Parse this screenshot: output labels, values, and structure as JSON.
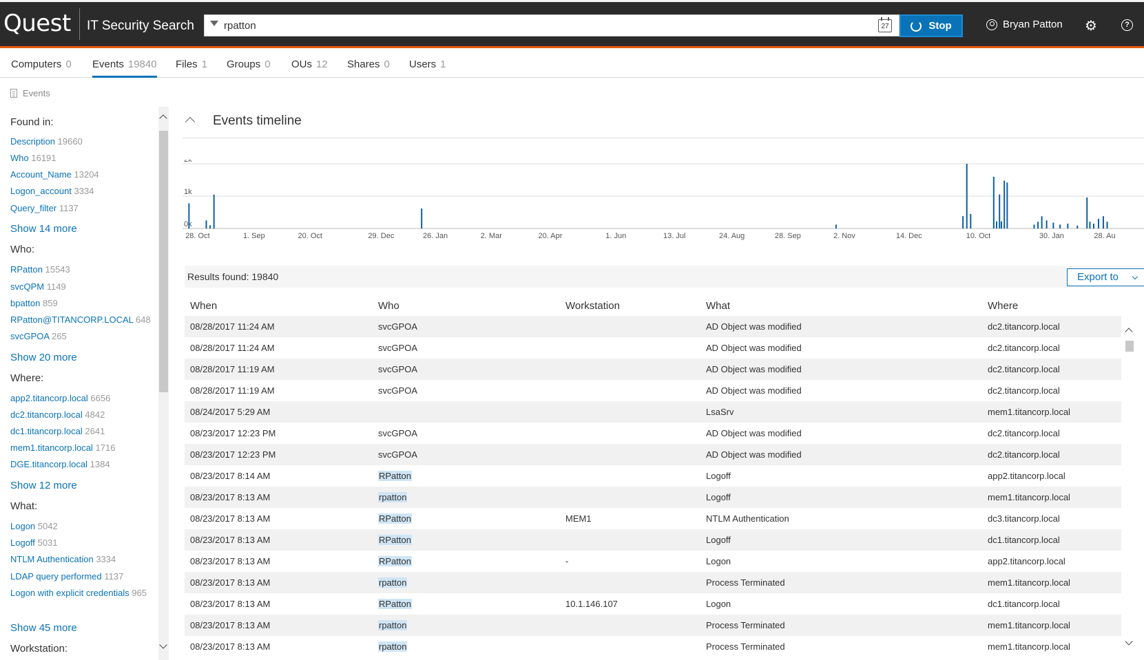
{
  "header": {
    "logo": "Quest",
    "app_title": "IT Security Search",
    "search_value": "rpatton",
    "calendar_day": "27",
    "stop_label": "Stop",
    "user_name": "Bryan Patton",
    "help_glyph": "?"
  },
  "tabs": [
    {
      "label": "Computers",
      "count": "0"
    },
    {
      "label": "Events",
      "count": "19840",
      "active": true
    },
    {
      "label": "Files",
      "count": "1"
    },
    {
      "label": "Groups",
      "count": "0"
    },
    {
      "label": "OUs",
      "count": "12"
    },
    {
      "label": "Shares",
      "count": "0"
    },
    {
      "label": "Users",
      "count": "1"
    }
  ],
  "breadcrumb": "Events",
  "facets": {
    "found_in": {
      "title": "Found in:",
      "items": [
        {
          "label": "Description",
          "count": "19660"
        },
        {
          "label": "Who",
          "count": "16191"
        },
        {
          "label": "Account_Name",
          "count": "13204"
        },
        {
          "label": "Logon_account",
          "count": "3334"
        },
        {
          "label": "Query_filter",
          "count": "1137"
        }
      ],
      "more": "Show 14 more"
    },
    "who": {
      "title": "Who:",
      "items": [
        {
          "label": "RPatton",
          "count": "15543"
        },
        {
          "label": "svcQPM",
          "count": "1149"
        },
        {
          "label": "bpatton",
          "count": "859"
        },
        {
          "label": "RPatton@TITANCORP.LOCAL",
          "count": "648"
        },
        {
          "label": "svcGPOA",
          "count": "265"
        }
      ],
      "more": "Show 20 more"
    },
    "where": {
      "title": "Where:",
      "items": [
        {
          "label": "app2.titancorp.local",
          "count": "6656"
        },
        {
          "label": "dc2.titancorp.local",
          "count": "4842"
        },
        {
          "label": "dc1.titancorp.local",
          "count": "2641"
        },
        {
          "label": "mem1.titancorp.local",
          "count": "1716"
        },
        {
          "label": "DGE.titancorp.local",
          "count": "1384"
        }
      ],
      "more": "Show 12 more"
    },
    "what": {
      "title": "What:",
      "items": [
        {
          "label": "Logon",
          "count": "5042"
        },
        {
          "label": "Logoff",
          "count": "5031"
        },
        {
          "label": "NTLM Authentication",
          "count": "3334"
        },
        {
          "label": "LDAP query performed",
          "count": "1137"
        },
        {
          "label": "Logon with explicit credentials",
          "count": "965"
        }
      ],
      "more": "Show 45 more"
    },
    "workstation_title": "Workstation:"
  },
  "timeline": {
    "title": "Events timeline",
    "accent_color": "#0a5fa3"
  },
  "chart_data": {
    "type": "bar",
    "y_ticks": [
      "0k",
      "1k",
      "2k"
    ],
    "ylim": [
      0,
      2000
    ],
    "x_ticks": [
      "28. Oct",
      "1. Sep",
      "20. Oct",
      "29. Dec",
      "26. Jan",
      "2. Mar",
      "20. Apr",
      "1. Jun",
      "13. Jul",
      "24. Aug",
      "28. Sep",
      "2. Nov",
      "14. Dec",
      "10. Oct",
      "30. Jan",
      "28. Au"
    ],
    "x_tick_fraction": [
      0.003,
      0.063,
      0.12,
      0.193,
      0.25,
      0.31,
      0.37,
      0.44,
      0.5,
      0.558,
      0.616,
      0.677,
      0.742,
      0.815,
      0.891,
      0.948
    ],
    "bars": [
      {
        "x": 0.006,
        "v": 780
      },
      {
        "x": 0.024,
        "v": 250
      },
      {
        "x": 0.028,
        "v": 100
      },
      {
        "x": 0.032,
        "v": 1050
      },
      {
        "x": 0.248,
        "v": 620
      },
      {
        "x": 0.679,
        "v": 120
      },
      {
        "x": 0.811,
        "v": 380
      },
      {
        "x": 0.815,
        "v": 2000
      },
      {
        "x": 0.819,
        "v": 450
      },
      {
        "x": 0.843,
        "v": 1600
      },
      {
        "x": 0.846,
        "v": 220
      },
      {
        "x": 0.849,
        "v": 1050
      },
      {
        "x": 0.851,
        "v": 220
      },
      {
        "x": 0.854,
        "v": 1480
      },
      {
        "x": 0.857,
        "v": 1420
      },
      {
        "x": 0.885,
        "v": 120
      },
      {
        "x": 0.889,
        "v": 210
      },
      {
        "x": 0.893,
        "v": 380
      },
      {
        "x": 0.898,
        "v": 250
      },
      {
        "x": 0.905,
        "v": 180
      },
      {
        "x": 0.912,
        "v": 120
      },
      {
        "x": 0.92,
        "v": 150
      },
      {
        "x": 0.93,
        "v": 90
      },
      {
        "x": 0.94,
        "v": 960
      },
      {
        "x": 0.943,
        "v": 210
      },
      {
        "x": 0.947,
        "v": 150
      },
      {
        "x": 0.952,
        "v": 300
      },
      {
        "x": 0.957,
        "v": 380
      },
      {
        "x": 0.961,
        "v": 210
      }
    ]
  },
  "results": {
    "found_text": "Results found: 19840",
    "export_label": "Export to"
  },
  "table": {
    "columns": [
      "When",
      "Who",
      "Workstation",
      "What",
      "Where"
    ],
    "rows": [
      {
        "when": "08/28/2017 11:24 AM",
        "who": "svcGPOA",
        "hl": false,
        "ws": "",
        "what": "AD Object was modified",
        "where": "dc2.titancorp.local"
      },
      {
        "when": "08/28/2017 11:24 AM",
        "who": "svcGPOA",
        "hl": false,
        "ws": "",
        "what": "AD Object was modified",
        "where": "dc2.titancorp.local"
      },
      {
        "when": "08/28/2017 11:19 AM",
        "who": "svcGPOA",
        "hl": false,
        "ws": "",
        "what": "AD Object was modified",
        "where": "dc2.titancorp.local"
      },
      {
        "when": "08/28/2017 11:19 AM",
        "who": "svcGPOA",
        "hl": false,
        "ws": "",
        "what": "AD Object was modified",
        "where": "dc2.titancorp.local"
      },
      {
        "when": "08/24/2017 5:29 AM",
        "who": "",
        "hl": false,
        "ws": "",
        "what": "LsaSrv",
        "where": "mem1.titancorp.local"
      },
      {
        "when": "08/23/2017 12:23 PM",
        "who": "svcGPOA",
        "hl": false,
        "ws": "",
        "what": "AD Object was modified",
        "where": "dc2.titancorp.local"
      },
      {
        "when": "08/23/2017 12:23 PM",
        "who": "svcGPOA",
        "hl": false,
        "ws": "",
        "what": "AD Object was modified",
        "where": "dc2.titancorp.local"
      },
      {
        "when": "08/23/2017 8:14 AM",
        "who": "RPatton",
        "hl": true,
        "ws": "",
        "what": "Logoff",
        "where": "app2.titancorp.local"
      },
      {
        "when": "08/23/2017 8:13 AM",
        "who": "rpatton",
        "hl": true,
        "ws": "",
        "what": "Logoff",
        "where": "mem1.titancorp.local"
      },
      {
        "when": "08/23/2017 8:13 AM",
        "who": "RPatton",
        "hl": true,
        "ws": "MEM1",
        "what": "NTLM Authentication",
        "where": "dc3.titancorp.local"
      },
      {
        "when": "08/23/2017 8:13 AM",
        "who": "RPatton",
        "hl": true,
        "ws": "",
        "what": "Logoff",
        "where": "dc1.titancorp.local"
      },
      {
        "when": "08/23/2017 8:13 AM",
        "who": "RPatton",
        "hl": true,
        "ws": "-",
        "what": "Logon",
        "where": "app2.titancorp.local"
      },
      {
        "when": "08/23/2017 8:13 AM",
        "who": "rpatton",
        "hl": true,
        "ws": "",
        "what": "Process Terminated",
        "where": "mem1.titancorp.local"
      },
      {
        "when": "08/23/2017 8:13 AM",
        "who": "RPatton",
        "hl": true,
        "ws": "10.1.146.107",
        "what": "Logon",
        "where": "dc1.titancorp.local"
      },
      {
        "when": "08/23/2017 8:13 AM",
        "who": "rpatton",
        "hl": true,
        "ws": "",
        "what": "Process Terminated",
        "where": "mem1.titancorp.local"
      },
      {
        "when": "08/23/2017 8:13 AM",
        "who": "rpatton",
        "hl": true,
        "ws": "",
        "what": "Process Terminated",
        "where": "mem1.titancorp.local"
      }
    ]
  }
}
